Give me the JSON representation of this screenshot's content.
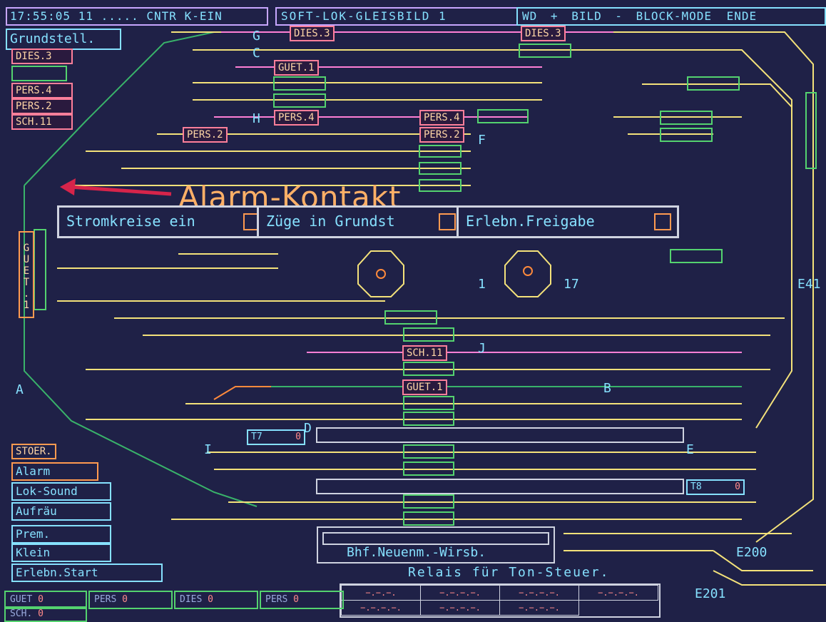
{
  "header": {
    "clock": "17:55:05",
    "status": "11 ..... CNTR K-EIN",
    "title": "SOFT-LOK-GLEISBILD 1",
    "menu": [
      "WD",
      "+",
      "BILD",
      "-",
      "BLOCK-MODE",
      "ENDE"
    ]
  },
  "top_left": {
    "grund_label": "Grundstell.",
    "train_list": [
      "DIES.3",
      "",
      "PERS.4",
      "PERS.2",
      "SCH.11"
    ]
  },
  "track_labels": [
    "DIES.3",
    "DIES.3",
    "GUET.1",
    "PERS.4",
    "PERS.4",
    "PERS.2",
    "PERS.2",
    "SCH.11",
    "GUET.1"
  ],
  "letters": {
    "G": "G",
    "C": "C",
    "H": "H",
    "F": "F",
    "A": "A",
    "J": "J",
    "B": "B",
    "D": "D",
    "I": "I",
    "E": "E",
    "E41": "E41",
    "E200": "E200",
    "E201": "E201",
    "one": "1",
    "seventeen": "17"
  },
  "annotation": {
    "alarm_kontakt": "Alarm-Kontakt"
  },
  "control_panels": {
    "stromkreise": "Stromkreise ein",
    "zuege": "Züge in Grundst",
    "freigabe": "Erlebn.Freigabe"
  },
  "side_vertical_label": "GUET.1",
  "timers": {
    "t7": "T7",
    "t7_value": "0",
    "t8": "T8",
    "t8_value": "0"
  },
  "stoer": {
    "title": "STOER.",
    "alarm": "Alarm",
    "lok_sound": "Lok-Sound",
    "aufraeu": "Aufräu",
    "prem": "Prem.",
    "klein": "Klein",
    "erlebn_start": "Erlebn.Start"
  },
  "bhf": {
    "label": "Bhf.Neuenm.-Wirsb."
  },
  "relais": {
    "label": "Relais für Ton-Steuer."
  },
  "bottom_counters": [
    {
      "name": "GUET",
      "value": "0"
    },
    {
      "name": "PERS",
      "value": "0"
    },
    {
      "name": "DIES",
      "value": "0"
    },
    {
      "name": "PERS",
      "value": "0"
    },
    {
      "name": "SCH.",
      "value": "0"
    }
  ],
  "colors": {
    "background": "#1f2147",
    "yellow_track": "#f4e27a",
    "green_track": "#39b36a",
    "pink_track": "#ff7fd6",
    "orange_track": "#ff8a3c",
    "cyan_text": "#86e1ff"
  }
}
